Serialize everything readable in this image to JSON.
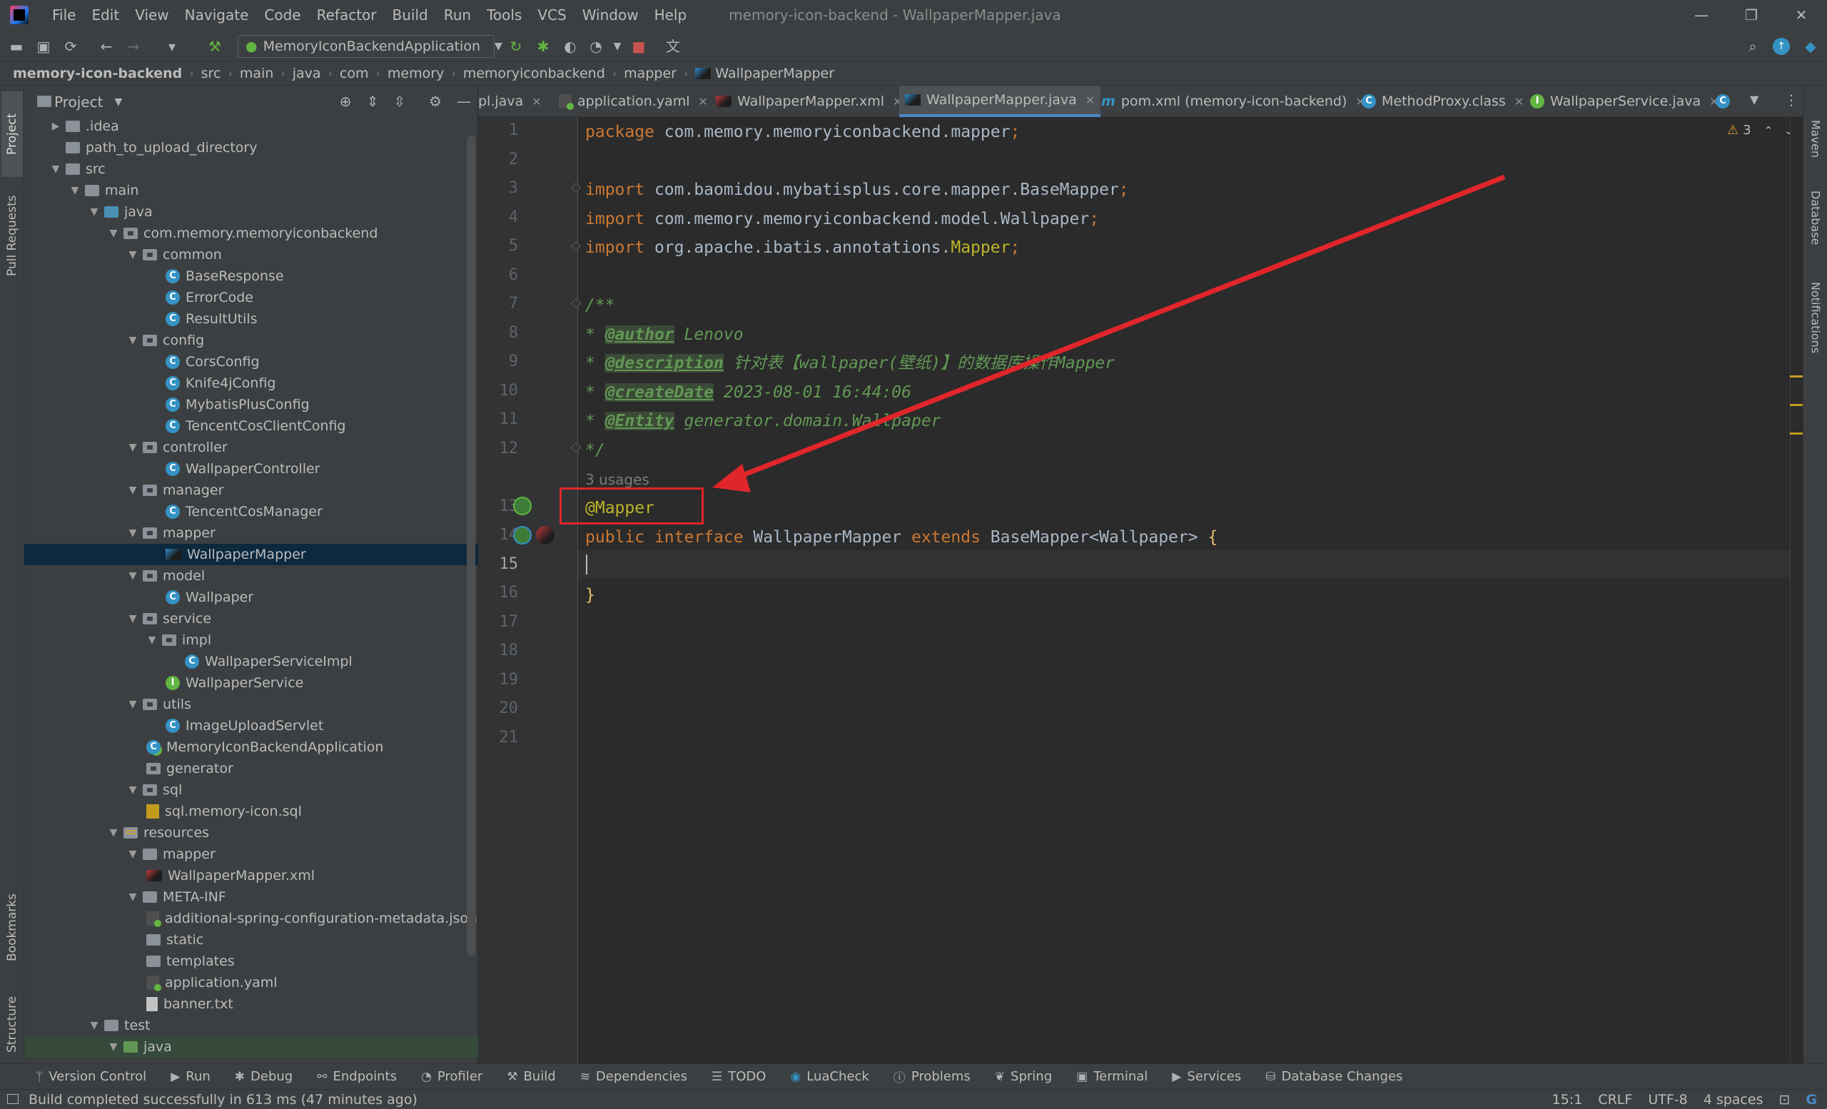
{
  "menubar": {
    "items": [
      "File",
      "Edit",
      "View",
      "Navigate",
      "Code",
      "Refactor",
      "Build",
      "Run",
      "Tools",
      "VCS",
      "Window",
      "Help"
    ],
    "window_title": "memory-icon-backend - WallpaperMapper.java"
  },
  "toolbar": {
    "run_config": "MemoryIconBackendApplication"
  },
  "breadcrumb": [
    "memory-icon-backend",
    "src",
    "main",
    "java",
    "com",
    "memory",
    "memoryiconbackend",
    "mapper",
    "WallpaperMapper"
  ],
  "left_strip": [
    "Project",
    "Pull Requests",
    "Bookmarks",
    "Structure"
  ],
  "right_strip": [
    "Maven",
    "Database",
    "Notifications"
  ],
  "project_panel": {
    "title": "Project",
    "tree": [
      {
        "label": ".idea"
      },
      {
        "label": "path_to_upload_directory"
      },
      {
        "label": "src"
      },
      {
        "label": "main"
      },
      {
        "label": "java"
      },
      {
        "label": "com.memory.memoryiconbackend"
      },
      {
        "label": "common"
      },
      {
        "label": "BaseResponse"
      },
      {
        "label": "ErrorCode"
      },
      {
        "label": "ResultUtils"
      },
      {
        "label": "config"
      },
      {
        "label": "CorsConfig"
      },
      {
        "label": "Knife4jConfig"
      },
      {
        "label": "MybatisPlusConfig"
      },
      {
        "label": "TencentCosClientConfig"
      },
      {
        "label": "controller"
      },
      {
        "label": "WallpaperController"
      },
      {
        "label": "manager"
      },
      {
        "label": "TencentCosManager"
      },
      {
        "label": "mapper"
      },
      {
        "label": "WallpaperMapper"
      },
      {
        "label": "model"
      },
      {
        "label": "Wallpaper"
      },
      {
        "label": "service"
      },
      {
        "label": "impl"
      },
      {
        "label": "WallpaperServiceImpl"
      },
      {
        "label": "WallpaperService"
      },
      {
        "label": "utils"
      },
      {
        "label": "ImageUploadServlet"
      },
      {
        "label": "MemoryIconBackendApplication"
      },
      {
        "label": "generator"
      },
      {
        "label": "sql"
      },
      {
        "label": "sql.memory-icon.sql"
      },
      {
        "label": "resources"
      },
      {
        "label": "mapper"
      },
      {
        "label": "WallpaperMapper.xml"
      },
      {
        "label": "META-INF"
      },
      {
        "label": "additional-spring-configuration-metadata.json"
      },
      {
        "label": "static"
      },
      {
        "label": "templates"
      },
      {
        "label": "application.yaml"
      },
      {
        "label": "banner.txt"
      },
      {
        "label": "test"
      },
      {
        "label": "java"
      }
    ]
  },
  "tabs": [
    {
      "label": "pl.java"
    },
    {
      "label": "application.yaml"
    },
    {
      "label": "WallpaperMapper.xml"
    },
    {
      "label": "WallpaperMapper.java"
    },
    {
      "label": "pom.xml (memory-icon-backend)"
    },
    {
      "label": "MethodProxy.class"
    },
    {
      "label": "WallpaperService.java"
    }
  ],
  "editor": {
    "warning_count": "3",
    "usages": "3 usages",
    "line_numbers": [
      "1",
      "2",
      "3",
      "4",
      "5",
      "6",
      "7",
      "8",
      "9",
      "10",
      "11",
      "12",
      "13",
      "14",
      "15",
      "16",
      "17",
      "18",
      "19",
      "20",
      "21"
    ],
    "code": {
      "package_kw": "package",
      "package_name": " com.memory.memoryiconbackend.mapper",
      "semi": ";",
      "import_kw": "import",
      "import1": " com.baomidou.mybatisplus.core.mapper.BaseMapper",
      "import2": " com.memory.memoryiconbackend.model.Wallpaper",
      "import3_a": " org.apache.ibatis.annotations.",
      "import3_b": "Mapper",
      "doc_open": "/**",
      "star": "* ",
      "author_tag": "@author",
      "author_val": " Lenovo",
      "desc_tag": "@description",
      "desc_val": " 针对表【wallpaper(壁纸)】的数据库操作Mapper",
      "date_tag": "@createDate",
      "date_val": " 2023-08-01 16:44:06",
      "entity_tag": "@Entity",
      "entity_val": " generator.domain.Wallpaper",
      "doc_close": "*/",
      "annotation": "@Mapper",
      "public_kw": "public",
      "interface_kw": " interface",
      "class_name": " WallpaperMapper",
      "extends_kw": " extends",
      "base": " BaseMapper",
      "generic_open": "<",
      "generic": "Wallpaper",
      "generic_close": ">",
      "open_brace": " {",
      "close_brace": "}"
    }
  },
  "bottom_tools": [
    "Version Control",
    "Run",
    "Debug",
    "Endpoints",
    "Profiler",
    "Build",
    "Dependencies",
    "TODO",
    "LuaCheck",
    "Problems",
    "Spring",
    "Terminal",
    "Services",
    "Database Changes"
  ],
  "status": {
    "message": "Build completed successfully in 613 ms (47 minutes ago)",
    "position": "15:1",
    "line_sep": "CRLF",
    "encoding": "UTF-8",
    "indent": "4 spaces"
  },
  "colors": {
    "keyword": "#cc7832",
    "annotation": "#bbb529",
    "doc": "#629755",
    "highlight_box": "#e0262a"
  }
}
